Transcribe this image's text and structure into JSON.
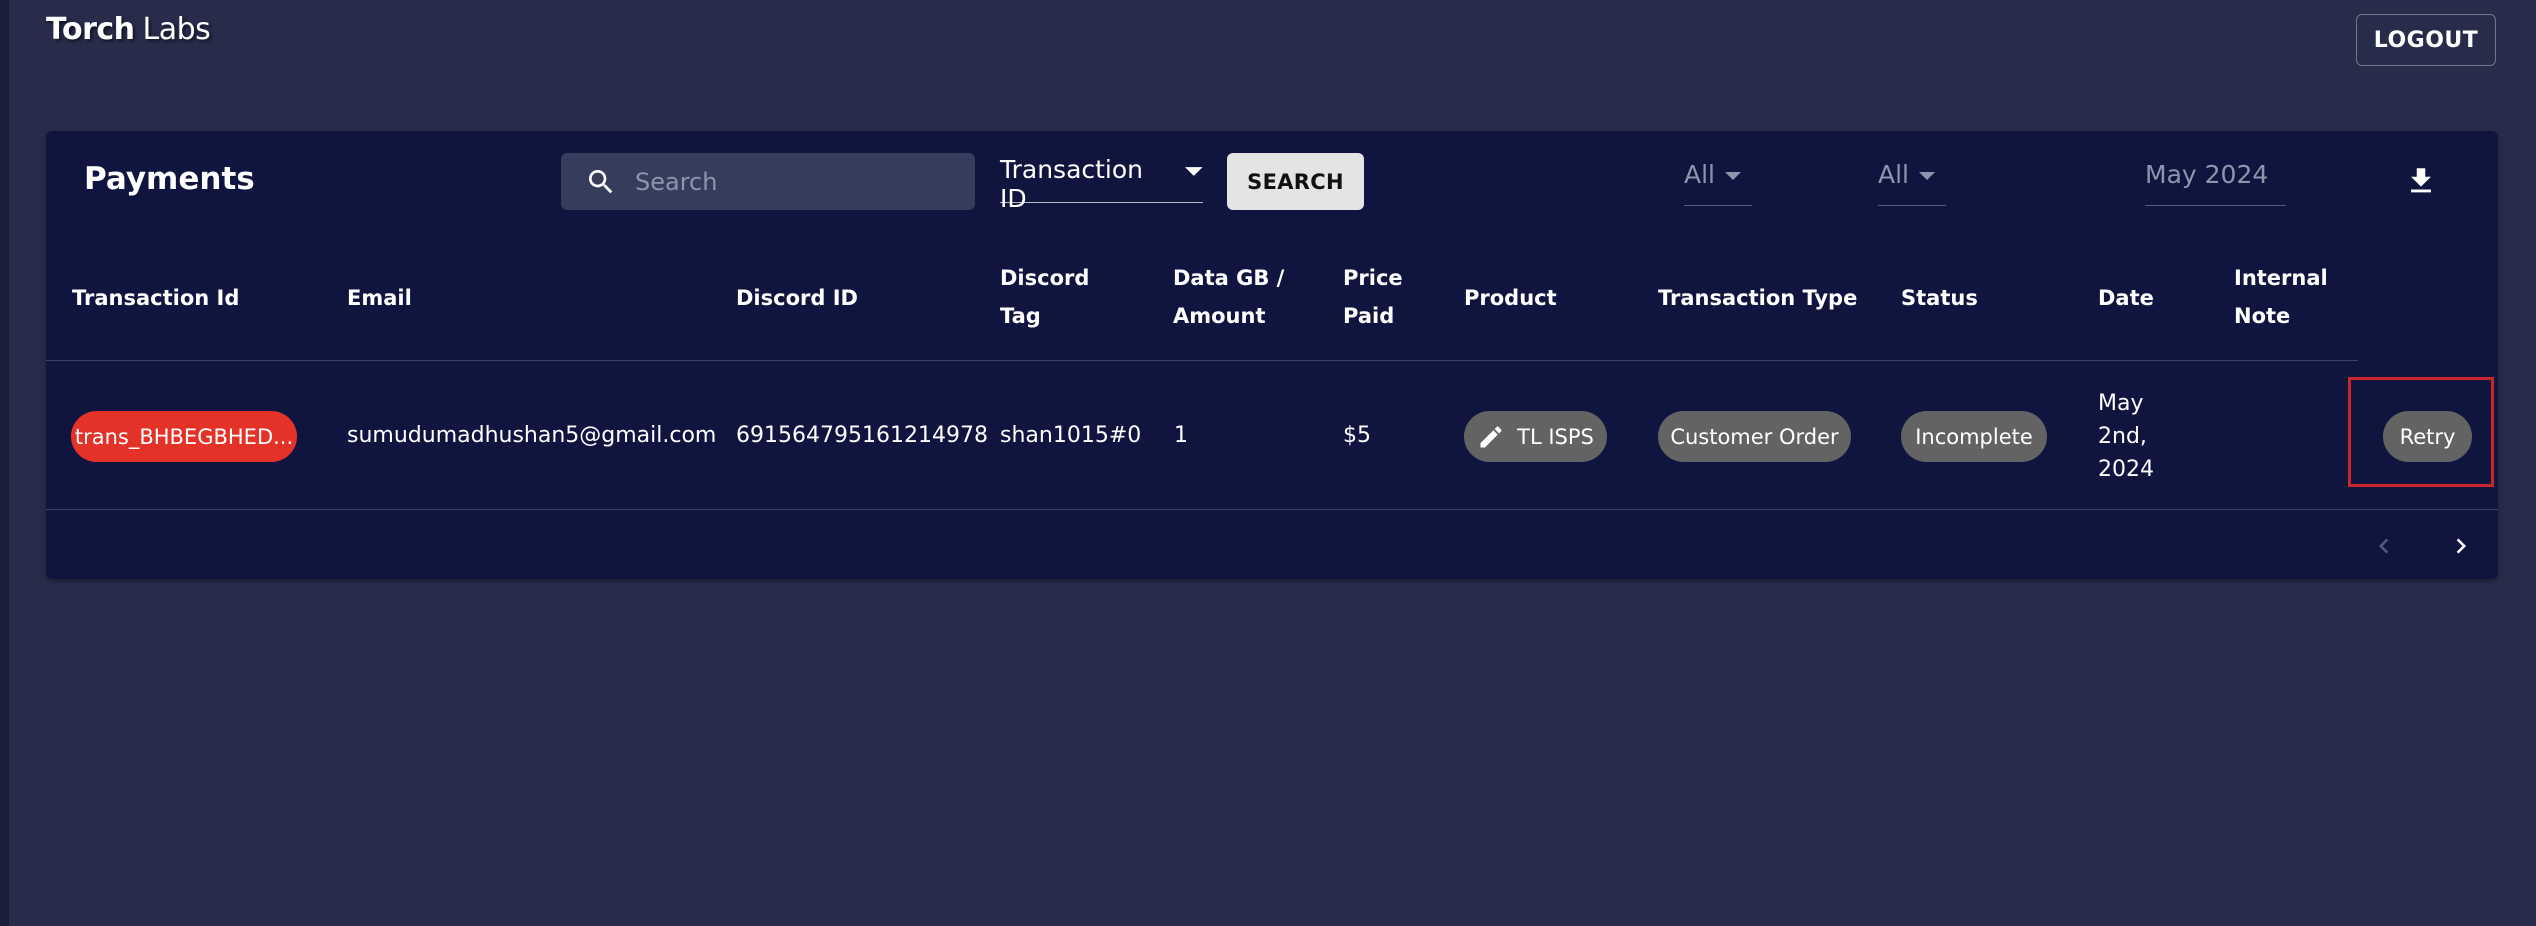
{
  "brand": {
    "bold": "Torch",
    "regular": "Labs"
  },
  "header": {
    "logout_label": "LOGOUT"
  },
  "card": {
    "title": "Payments"
  },
  "toolbar": {
    "search_placeholder": "Search",
    "search_field": "Transaction ID",
    "search_button": "SEARCH",
    "filter_1": "All",
    "filter_2": "All",
    "date_filter": "May 2024",
    "download_icon": "download-icon"
  },
  "table": {
    "headers": {
      "transaction_id": "Transaction Id",
      "email": "Email",
      "discord_id": "Discord ID",
      "discord_tag_1": "Discord",
      "discord_tag_2": "Tag",
      "data_amount_1": "Data GB /",
      "data_amount_2": "Amount",
      "price_1": "Price",
      "price_2": "Paid",
      "product": "Product",
      "transaction_type": "Transaction Type",
      "status": "Status",
      "date": "Date",
      "internal_note_1": "Internal",
      "internal_note_2": "Note"
    },
    "rows": [
      {
        "transaction_id": "trans_BHBEGBHED...",
        "email": "sumudumadhushan5@gmail.com",
        "discord_id": "691564795161214978",
        "discord_tag": "shan1015#0",
        "data_amount": "1",
        "price_paid": "$5",
        "product": "TL ISPS",
        "transaction_type": "Customer Order",
        "status": "Incomplete",
        "date_1": "May",
        "date_2": "2nd,",
        "date_3": "2024",
        "internal_note": "",
        "action": "Retry"
      }
    ]
  },
  "pagination": {
    "prev_icon": "chevron-left-icon",
    "next_icon": "chevron-right-icon"
  },
  "colors": {
    "background": "#282c4b",
    "card": "#101540",
    "transaction_pill": "#e53228",
    "neutral_pill": "#636363",
    "highlight": "#c8242c"
  }
}
